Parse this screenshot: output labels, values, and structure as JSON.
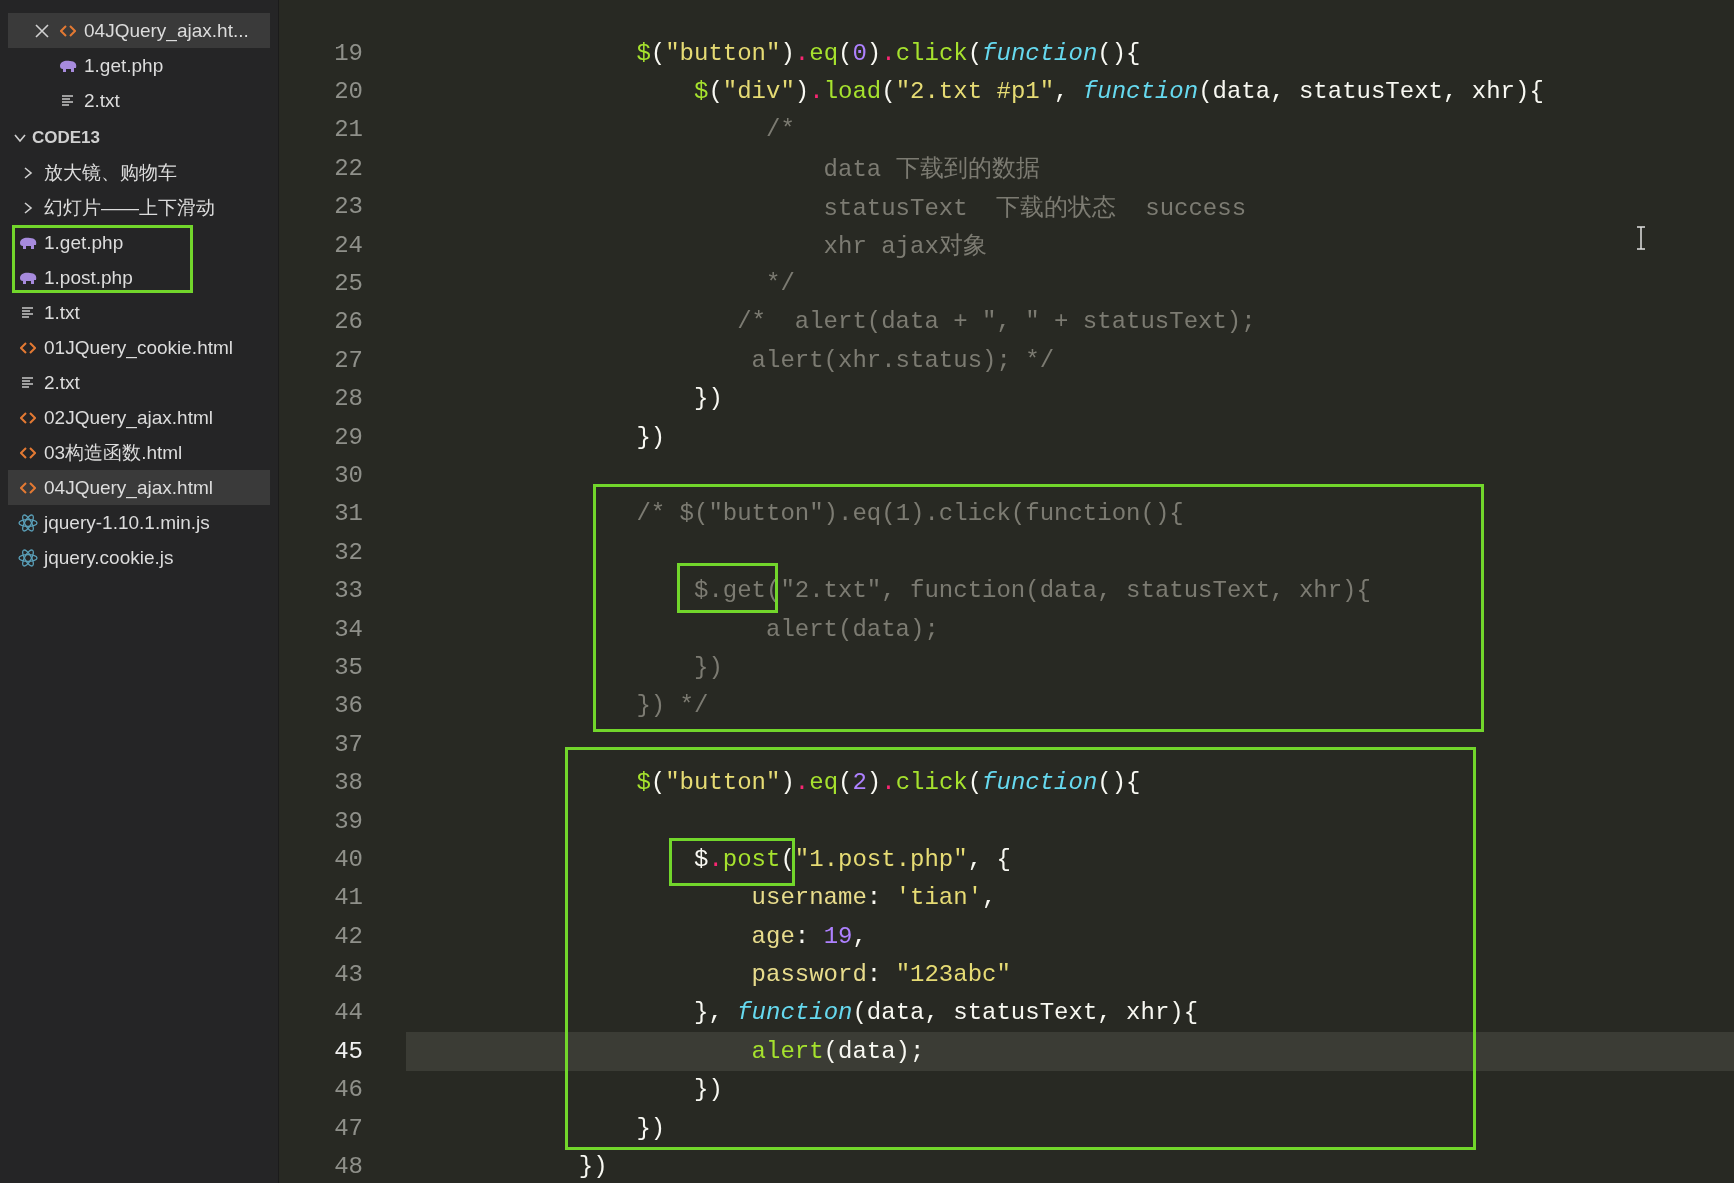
{
  "sidebar": {
    "open_editors": [
      {
        "name": "04JQuery_ajax.ht...",
        "kind": "html",
        "selected": true,
        "close_shown": true
      },
      {
        "name": "1.get.php",
        "kind": "php",
        "selected": false,
        "close_shown": false
      },
      {
        "name": "2.txt",
        "kind": "txt",
        "selected": false,
        "close_shown": false
      }
    ],
    "explorer": {
      "title": "CODE13",
      "expanded": true,
      "items": [
        {
          "name": "放大镜、购物车",
          "kind": "folder",
          "expanded": false,
          "selected": false
        },
        {
          "name": "幻灯片——上下滑动",
          "kind": "folder",
          "expanded": false,
          "selected": false
        },
        {
          "name": "1.get.php",
          "kind": "php",
          "selected": false
        },
        {
          "name": "1.post.php",
          "kind": "php",
          "selected": false
        },
        {
          "name": "1.txt",
          "kind": "txt",
          "selected": false
        },
        {
          "name": "01JQuery_cookie.html",
          "kind": "html",
          "selected": false
        },
        {
          "name": "2.txt",
          "kind": "txt",
          "selected": false
        },
        {
          "name": "02JQuery_ajax.html",
          "kind": "html",
          "selected": false
        },
        {
          "name": "03构造函数.html",
          "kind": "html",
          "selected": false
        },
        {
          "name": "04JQuery_ajax.html",
          "kind": "html",
          "selected": true
        },
        {
          "name": "jquery-1.10.1.min.js",
          "kind": "js",
          "selected": false
        },
        {
          "name": "jquery.cookie.js",
          "kind": "js",
          "selected": false
        }
      ]
    }
  },
  "editor": {
    "lines": [
      {
        "number": "19",
        "current": false,
        "tokens": [
          {
            "text": "$",
            "kind": "fn"
          },
          {
            "text": "(",
            "kind": "plain"
          },
          {
            "text": "\"button\"",
            "kind": "str"
          },
          {
            "text": ")",
            "kind": "plain"
          },
          {
            "text": ".",
            "kind": "op"
          },
          {
            "text": "eq",
            "kind": "fn"
          },
          {
            "text": "(",
            "kind": "plain"
          },
          {
            "text": "0",
            "kind": "num"
          },
          {
            "text": ")",
            "kind": "plain"
          },
          {
            "text": ".",
            "kind": "op"
          },
          {
            "text": "click",
            "kind": "fn"
          },
          {
            "text": "(",
            "kind": "plain"
          },
          {
            "text": "function",
            "kind": "kw"
          },
          {
            "text": "(){",
            "kind": "plain"
          }
        ]
      },
      {
        "number": "20",
        "current": false,
        "tokens": [
          {
            "text": "$",
            "kind": "fn"
          },
          {
            "text": "(",
            "kind": "plain"
          },
          {
            "text": "\"div\"",
            "kind": "str"
          },
          {
            "text": ")",
            "kind": "plain"
          },
          {
            "text": ".",
            "kind": "op"
          },
          {
            "text": "load",
            "kind": "fn"
          },
          {
            "text": "(",
            "kind": "plain"
          },
          {
            "text": "\"2.txt #p1\"",
            "kind": "str"
          },
          {
            "text": ", ",
            "kind": "plain"
          },
          {
            "text": "function",
            "kind": "kw"
          },
          {
            "text": "(data, statusText, xhr){",
            "kind": "plain"
          }
        ]
      },
      {
        "number": "21",
        "current": false,
        "tokens": [
          {
            "text": "/*",
            "kind": "comment"
          }
        ]
      },
      {
        "number": "22",
        "current": false,
        "tokens": [
          {
            "text": "data 下载到的数据",
            "kind": "comment"
          }
        ]
      },
      {
        "number": "23",
        "current": false,
        "tokens": [
          {
            "text": "statusText  下载的状态  success",
            "kind": "comment"
          }
        ]
      },
      {
        "number": "24",
        "current": false,
        "tokens": [
          {
            "text": "xhr ajax对象",
            "kind": "comment"
          }
        ]
      },
      {
        "number": "25",
        "current": false,
        "tokens": [
          {
            "text": "*/",
            "kind": "comment"
          }
        ]
      },
      {
        "number": "26",
        "current": false,
        "tokens": [
          {
            "text": "/*  alert(data + \", \" + statusText);",
            "kind": "comment"
          }
        ]
      },
      {
        "number": "27",
        "current": false,
        "tokens": [
          {
            "text": "alert(xhr.status); */",
            "kind": "comment"
          }
        ]
      },
      {
        "number": "28",
        "current": false,
        "tokens": [
          {
            "text": "})",
            "kind": "plain"
          }
        ]
      },
      {
        "number": "29",
        "current": false,
        "tokens": [
          {
            "text": "})",
            "kind": "plain"
          }
        ]
      },
      {
        "number": "30",
        "current": false
      },
      {
        "number": "31",
        "current": false,
        "tokens": [
          {
            "text": "/* $(\"button\").eq(1).click(function(){",
            "kind": "comment"
          }
        ]
      },
      {
        "number": "32",
        "current": false
      },
      {
        "number": "33",
        "current": false,
        "tokens": [
          {
            "text": "$.get(\"2.txt\", function(data, statusText, xhr){",
            "kind": "comment"
          }
        ]
      },
      {
        "number": "34",
        "current": false,
        "tokens": [
          {
            "text": "alert(data);",
            "kind": "comment"
          }
        ]
      },
      {
        "number": "35",
        "current": false,
        "tokens": [
          {
            "text": "})",
            "kind": "comment"
          }
        ]
      },
      {
        "number": "36",
        "current": false,
        "tokens": [
          {
            "text": "}) */",
            "kind": "comment"
          }
        ]
      },
      {
        "number": "37",
        "current": false
      },
      {
        "number": "38",
        "current": false,
        "tokens": [
          {
            "text": "$",
            "kind": "fn"
          },
          {
            "text": "(",
            "kind": "plain"
          },
          {
            "text": "\"button\"",
            "kind": "str"
          },
          {
            "text": ")",
            "kind": "plain"
          },
          {
            "text": ".",
            "kind": "op"
          },
          {
            "text": "eq",
            "kind": "fn"
          },
          {
            "text": "(",
            "kind": "plain"
          },
          {
            "text": "2",
            "kind": "num"
          },
          {
            "text": ")",
            "kind": "plain"
          },
          {
            "text": ".",
            "kind": "op"
          },
          {
            "text": "click",
            "kind": "fn"
          },
          {
            "text": "(",
            "kind": "plain"
          },
          {
            "text": "function",
            "kind": "kw"
          },
          {
            "text": "(){",
            "kind": "plain"
          }
        ]
      },
      {
        "number": "39",
        "current": false
      },
      {
        "number": "40",
        "current": false,
        "tokens": [
          {
            "text": "$",
            "kind": "plain"
          },
          {
            "text": ".",
            "kind": "op"
          },
          {
            "text": "post",
            "kind": "fn"
          },
          {
            "text": "(",
            "kind": "plain"
          },
          {
            "text": "\"1.post.php\"",
            "kind": "str"
          },
          {
            "text": ", {",
            "kind": "plain"
          }
        ]
      },
      {
        "number": "41",
        "current": false,
        "tokens": [
          {
            "text": "username",
            "kind": "prop"
          },
          {
            "text": ": ",
            "kind": "plain"
          },
          {
            "text": "'tian'",
            "kind": "str"
          },
          {
            "text": ",",
            "kind": "plain"
          }
        ]
      },
      {
        "number": "42",
        "current": false,
        "tokens": [
          {
            "text": "age",
            "kind": "prop"
          },
          {
            "text": ": ",
            "kind": "plain"
          },
          {
            "text": "19",
            "kind": "num"
          },
          {
            "text": ",",
            "kind": "plain"
          }
        ]
      },
      {
        "number": "43",
        "current": false,
        "tokens": [
          {
            "text": "password",
            "kind": "prop"
          },
          {
            "text": ": ",
            "kind": "plain"
          },
          {
            "text": "\"123abc\"",
            "kind": "str"
          }
        ]
      },
      {
        "number": "44",
        "current": false,
        "tokens": [
          {
            "text": "}, ",
            "kind": "plain"
          },
          {
            "text": "function",
            "kind": "kw"
          },
          {
            "text": "(data, statusText, xhr){",
            "kind": "plain"
          }
        ]
      },
      {
        "number": "45",
        "current": true,
        "tokens": [
          {
            "text": "alert",
            "kind": "fn"
          },
          {
            "text": "(data);",
            "kind": "plain"
          }
        ]
      },
      {
        "number": "46",
        "current": false,
        "tokens": [
          {
            "text": "})",
            "kind": "plain"
          }
        ]
      },
      {
        "number": "47",
        "current": false,
        "tokens": [
          {
            "text": "})",
            "kind": "plain"
          }
        ]
      },
      {
        "number": "48",
        "current": false,
        "tokens": [
          {
            "text": "})",
            "kind": "plain"
          }
        ]
      }
    ]
  }
}
